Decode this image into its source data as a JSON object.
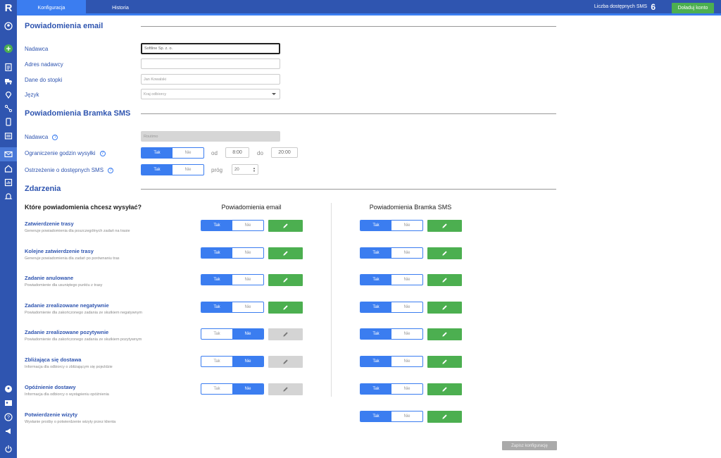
{
  "app": {
    "logo": "R"
  },
  "tabs": [
    {
      "label": "Konfiguracja",
      "active": true
    },
    {
      "label": "Historia",
      "active": false
    }
  ],
  "header": {
    "sms_label": "Liczba dostępnych SMS",
    "sms_count": "6",
    "topup_label": "Doładuj konto"
  },
  "sidebar_icons": [
    "user-circle-icon",
    "routes-icon",
    "clipboard-icon",
    "truck-icon",
    "location-pin-icon",
    "nodes-icon",
    "mobile-icon",
    "id-card-icon",
    "mail-icon",
    "home-icon",
    "report-icon",
    "bell-icon",
    "user-group-icon",
    "contacts-icon",
    "help-icon",
    "megaphone-icon",
    "power-icon"
  ],
  "email_section": {
    "title": "Powiadomienia email",
    "fields": [
      {
        "label": "Nadawca",
        "value": "Softline Sp. z. o."
      },
      {
        "label": "Adres nadawcy",
        "value": ""
      },
      {
        "label": "Dane do stopki",
        "value": "Jan Kowalski"
      },
      {
        "label": "Język",
        "value": "Kraj odbiorcy"
      }
    ]
  },
  "sms_section": {
    "title": "Powiadomienia Bramka SMS",
    "sender_label": "Nadawca",
    "sender_value": "Routimo",
    "hours_label": "Ograniczenie godzin wysyłki",
    "from_label": "od",
    "from_value": "8:00",
    "to_label": "do",
    "to_value": "20:00",
    "warning_label": "Ostrzeżenie o dostępnych SMS",
    "threshold_label": "próg",
    "threshold_value": "20"
  },
  "toggle_labels": {
    "yes": "Tak",
    "no": "Nie"
  },
  "events_section": {
    "title": "Zdarzenia",
    "question": "Które powiadomienia chcesz wysyłać?",
    "email_column": "Powiadomienia email",
    "sms_column": "Powiadomienia Bramka SMS",
    "events": [
      {
        "title": "Zatwierdzenie trasy",
        "desc": "Generuje powiadomienia dla poszczególnych zadań na trasie",
        "email": "yes",
        "sms": "yes"
      },
      {
        "title": "Kolejne zatwierdzenie trasy",
        "desc": "Generuje powiadomienia dla zadań po porównaniu tras",
        "email": "yes",
        "sms": "yes"
      },
      {
        "title": "Zadanie anulowane",
        "desc": "Powiadomienie dla usuniętego punktu z trasy",
        "email": "yes",
        "sms": "yes"
      },
      {
        "title": "Zadanie zrealizowane negatywnie",
        "desc": "Powiadomienie dla zakończonego zadania ze skutkiem negatywnym",
        "email": "yes",
        "sms": "yes"
      },
      {
        "title": "Zadanie zrealizowane pozytywnie",
        "desc": "Powiadomienie dla zakończonego zadania ze skutkiem pozytywnym",
        "email": "no",
        "sms": "yes"
      },
      {
        "title": "Zbliżająca się dostawa",
        "desc": "Informacja dla odbiorcy o zbliżającym się pojeździe",
        "email": "no",
        "sms": "yes"
      },
      {
        "title": "Opóźnienie dostawy",
        "desc": "Informacja dla odbiorcy o wystąpieniu opóźnienia",
        "email": "no",
        "sms": "yes"
      },
      {
        "title": "Potwierdzenie wizyty",
        "desc": "Wysłanie prośby o potwierdzenie wizyty przez klienta",
        "email": null,
        "sms": "yes"
      }
    ]
  },
  "save_label": "Zapisz konfigurację",
  "colors": {
    "primary": "#2f55b0",
    "accent": "#3b7df0",
    "success": "#4caf50"
  }
}
